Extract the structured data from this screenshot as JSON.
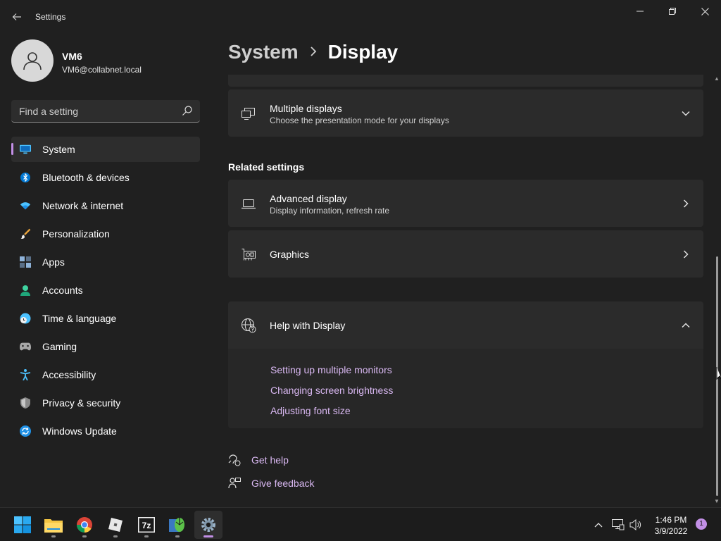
{
  "window": {
    "title": "Settings",
    "back_label": "Back",
    "controls": {
      "minimize": "Minimize",
      "maximize": "Restore",
      "close": "Close"
    }
  },
  "user": {
    "name": "VM6",
    "email": "VM6@collabnet.local"
  },
  "search": {
    "placeholder": "Find a setting"
  },
  "sidebar": {
    "items": [
      {
        "label": "System",
        "icon": "system-icon",
        "active": true
      },
      {
        "label": "Bluetooth & devices",
        "icon": "bluetooth-icon"
      },
      {
        "label": "Network & internet",
        "icon": "wifi-icon"
      },
      {
        "label": "Personalization",
        "icon": "brush-icon"
      },
      {
        "label": "Apps",
        "icon": "apps-icon"
      },
      {
        "label": "Accounts",
        "icon": "accounts-icon"
      },
      {
        "label": "Time & language",
        "icon": "globe-clock-icon"
      },
      {
        "label": "Gaming",
        "icon": "gamepad-icon"
      },
      {
        "label": "Accessibility",
        "icon": "accessibility-icon"
      },
      {
        "label": "Privacy & security",
        "icon": "shield-icon"
      },
      {
        "label": "Windows Update",
        "icon": "update-icon"
      }
    ]
  },
  "main": {
    "breadcrumb": {
      "parent": "System",
      "current": "Display"
    },
    "multiple_displays": {
      "title": "Multiple displays",
      "subtitle": "Choose the presentation mode for your displays"
    },
    "related_settings": {
      "heading": "Related settings",
      "advanced_display": {
        "title": "Advanced display",
        "subtitle": "Display information, refresh rate"
      },
      "graphics": {
        "title": "Graphics"
      }
    },
    "help": {
      "title": "Help with Display",
      "links": [
        "Setting up multiple monitors",
        "Changing screen brightness",
        "Adjusting font size"
      ]
    },
    "footer": {
      "get_help": "Get help",
      "give_feedback": "Give feedback"
    }
  },
  "taskbar": {
    "apps": [
      "start-icon",
      "file-explorer-icon",
      "chrome-icon",
      "roblox-icon",
      "7zip-icon",
      "mouse-app-icon",
      "settings-icon"
    ],
    "tray": [
      "chevron-up-icon",
      "network-icon",
      "volume-icon"
    ],
    "time": "1:46 PM",
    "date": "3/9/2022",
    "notification_count": "1"
  },
  "colors": {
    "accent": "#c28fe6",
    "link": "#d9b8f2",
    "background": "#202020",
    "card": "#2b2b2b"
  }
}
